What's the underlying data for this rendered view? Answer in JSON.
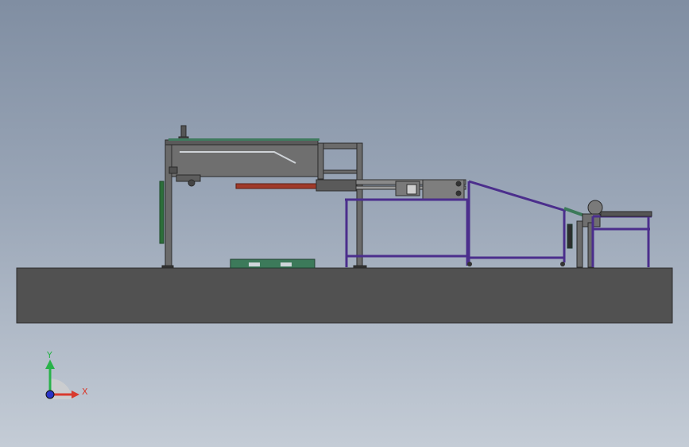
{
  "viewport": {
    "background_top": "#808ea2",
    "background_bottom": "#c4ccd6"
  },
  "model": {
    "floor_color": "#515151",
    "frame_color": "#6b6b6b",
    "conveyor_frame_color": "#4b2e8c",
    "red_bar_color": "#a03a2a",
    "green_panel_color": "#3c7a5a"
  },
  "triad": {
    "y_label": "Y",
    "x_label": "X",
    "y_color": "#29b24a",
    "x_color": "#d83a2e",
    "z_color": "#2a34c8"
  }
}
